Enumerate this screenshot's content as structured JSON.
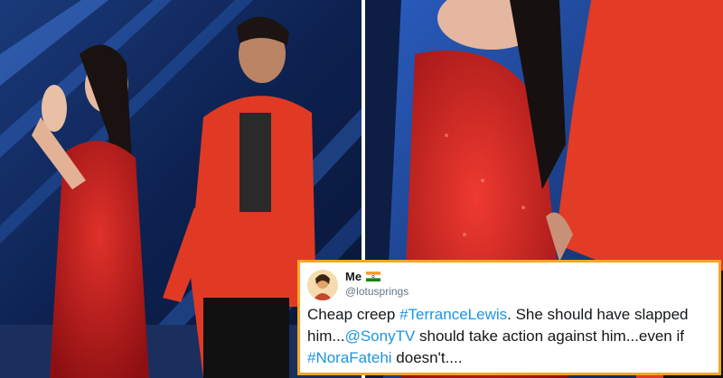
{
  "tweet": {
    "name": "Me",
    "handle": "@lotusprings",
    "text": {
      "p1": "Cheap creep ",
      "tag1": "#TerranceLewis",
      "p2": ". She should have slapped him...",
      "tag2": "@SonyTV",
      "p3": " should take action against him...even if ",
      "tag3": "#NoraFatehi",
      "p4": "  doesn't...."
    },
    "flag_icon": "india-flag-icon",
    "colors": {
      "link": "#1b95e0",
      "border": "#f5a623"
    }
  },
  "photos": {
    "left": "stage-photo-icon",
    "right": "closeup-photo-icon"
  }
}
